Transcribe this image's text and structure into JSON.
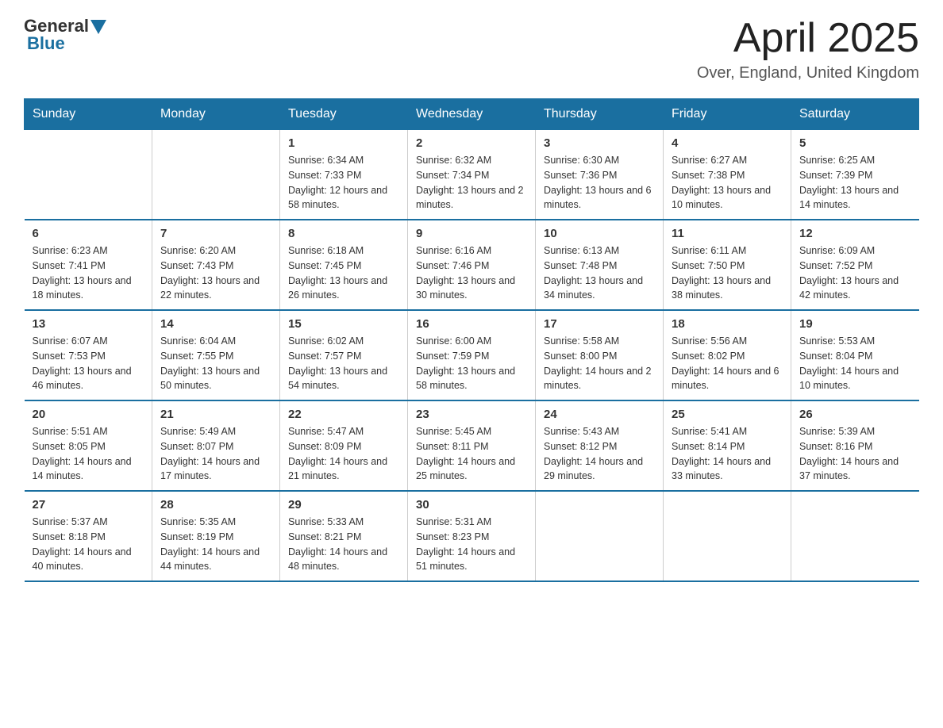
{
  "header": {
    "logo_general": "General",
    "logo_blue": "Blue",
    "month_title": "April 2025",
    "location": "Over, England, United Kingdom"
  },
  "days_of_week": [
    "Sunday",
    "Monday",
    "Tuesday",
    "Wednesday",
    "Thursday",
    "Friday",
    "Saturday"
  ],
  "weeks": [
    [
      {
        "day": "",
        "info": ""
      },
      {
        "day": "",
        "info": ""
      },
      {
        "day": "1",
        "info": "Sunrise: 6:34 AM\nSunset: 7:33 PM\nDaylight: 12 hours\nand 58 minutes."
      },
      {
        "day": "2",
        "info": "Sunrise: 6:32 AM\nSunset: 7:34 PM\nDaylight: 13 hours\nand 2 minutes."
      },
      {
        "day": "3",
        "info": "Sunrise: 6:30 AM\nSunset: 7:36 PM\nDaylight: 13 hours\nand 6 minutes."
      },
      {
        "day": "4",
        "info": "Sunrise: 6:27 AM\nSunset: 7:38 PM\nDaylight: 13 hours\nand 10 minutes."
      },
      {
        "day": "5",
        "info": "Sunrise: 6:25 AM\nSunset: 7:39 PM\nDaylight: 13 hours\nand 14 minutes."
      }
    ],
    [
      {
        "day": "6",
        "info": "Sunrise: 6:23 AM\nSunset: 7:41 PM\nDaylight: 13 hours\nand 18 minutes."
      },
      {
        "day": "7",
        "info": "Sunrise: 6:20 AM\nSunset: 7:43 PM\nDaylight: 13 hours\nand 22 minutes."
      },
      {
        "day": "8",
        "info": "Sunrise: 6:18 AM\nSunset: 7:45 PM\nDaylight: 13 hours\nand 26 minutes."
      },
      {
        "day": "9",
        "info": "Sunrise: 6:16 AM\nSunset: 7:46 PM\nDaylight: 13 hours\nand 30 minutes."
      },
      {
        "day": "10",
        "info": "Sunrise: 6:13 AM\nSunset: 7:48 PM\nDaylight: 13 hours\nand 34 minutes."
      },
      {
        "day": "11",
        "info": "Sunrise: 6:11 AM\nSunset: 7:50 PM\nDaylight: 13 hours\nand 38 minutes."
      },
      {
        "day": "12",
        "info": "Sunrise: 6:09 AM\nSunset: 7:52 PM\nDaylight: 13 hours\nand 42 minutes."
      }
    ],
    [
      {
        "day": "13",
        "info": "Sunrise: 6:07 AM\nSunset: 7:53 PM\nDaylight: 13 hours\nand 46 minutes."
      },
      {
        "day": "14",
        "info": "Sunrise: 6:04 AM\nSunset: 7:55 PM\nDaylight: 13 hours\nand 50 minutes."
      },
      {
        "day": "15",
        "info": "Sunrise: 6:02 AM\nSunset: 7:57 PM\nDaylight: 13 hours\nand 54 minutes."
      },
      {
        "day": "16",
        "info": "Sunrise: 6:00 AM\nSunset: 7:59 PM\nDaylight: 13 hours\nand 58 minutes."
      },
      {
        "day": "17",
        "info": "Sunrise: 5:58 AM\nSunset: 8:00 PM\nDaylight: 14 hours\nand 2 minutes."
      },
      {
        "day": "18",
        "info": "Sunrise: 5:56 AM\nSunset: 8:02 PM\nDaylight: 14 hours\nand 6 minutes."
      },
      {
        "day": "19",
        "info": "Sunrise: 5:53 AM\nSunset: 8:04 PM\nDaylight: 14 hours\nand 10 minutes."
      }
    ],
    [
      {
        "day": "20",
        "info": "Sunrise: 5:51 AM\nSunset: 8:05 PM\nDaylight: 14 hours\nand 14 minutes."
      },
      {
        "day": "21",
        "info": "Sunrise: 5:49 AM\nSunset: 8:07 PM\nDaylight: 14 hours\nand 17 minutes."
      },
      {
        "day": "22",
        "info": "Sunrise: 5:47 AM\nSunset: 8:09 PM\nDaylight: 14 hours\nand 21 minutes."
      },
      {
        "day": "23",
        "info": "Sunrise: 5:45 AM\nSunset: 8:11 PM\nDaylight: 14 hours\nand 25 minutes."
      },
      {
        "day": "24",
        "info": "Sunrise: 5:43 AM\nSunset: 8:12 PM\nDaylight: 14 hours\nand 29 minutes."
      },
      {
        "day": "25",
        "info": "Sunrise: 5:41 AM\nSunset: 8:14 PM\nDaylight: 14 hours\nand 33 minutes."
      },
      {
        "day": "26",
        "info": "Sunrise: 5:39 AM\nSunset: 8:16 PM\nDaylight: 14 hours\nand 37 minutes."
      }
    ],
    [
      {
        "day": "27",
        "info": "Sunrise: 5:37 AM\nSunset: 8:18 PM\nDaylight: 14 hours\nand 40 minutes."
      },
      {
        "day": "28",
        "info": "Sunrise: 5:35 AM\nSunset: 8:19 PM\nDaylight: 14 hours\nand 44 minutes."
      },
      {
        "day": "29",
        "info": "Sunrise: 5:33 AM\nSunset: 8:21 PM\nDaylight: 14 hours\nand 48 minutes."
      },
      {
        "day": "30",
        "info": "Sunrise: 5:31 AM\nSunset: 8:23 PM\nDaylight: 14 hours\nand 51 minutes."
      },
      {
        "day": "",
        "info": ""
      },
      {
        "day": "",
        "info": ""
      },
      {
        "day": "",
        "info": ""
      }
    ]
  ]
}
